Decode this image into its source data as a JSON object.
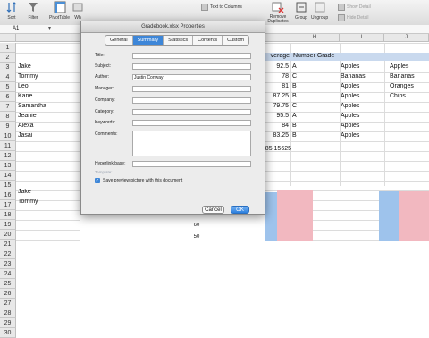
{
  "ribbon": {
    "sort_label": "Sort",
    "filter_label": "Filter",
    "pivot_label": "PivotTable",
    "wh_label": "Wh",
    "text_to_columns": "Text to Columns",
    "remove_duplicates": "Remove Duplicates",
    "group_label": "Group",
    "ungroup_label": "Ungroup",
    "show_detail": "Show Detail",
    "hide_detail": "Hide Detail"
  },
  "formula_bar": {
    "cell_ref": "A1"
  },
  "columns": [
    "H",
    "I",
    "J"
  ],
  "rows": {
    "numbers": [
      "1",
      "2",
      "3",
      "4",
      "5",
      "6",
      "7",
      "8",
      "9",
      "10",
      "11",
      "12",
      "13",
      "14",
      "15",
      "16",
      "17",
      "18",
      "19",
      "20",
      "21",
      "22",
      "23",
      "24",
      "25",
      "26",
      "27",
      "28",
      "29",
      "30"
    ],
    "names": [
      "Jake",
      "Tommy",
      "Leo",
      "Kane",
      "Samantha",
      "Jeanie",
      "Alexa",
      "Jasai"
    ],
    "names_lower": [
      "Jake",
      "Tommy"
    ]
  },
  "sheet": {
    "header_g": "verage",
    "header_h": "Number Grade",
    "averages": [
      "92.5",
      "78",
      "81",
      "87.25",
      "79.75",
      "95.5",
      "84",
      "83.25"
    ],
    "grades": [
      "A",
      "C",
      "B",
      "B",
      "C",
      "A",
      "B",
      "B"
    ],
    "col_i": [
      "Apples",
      "Bananas",
      "Apples",
      "Apples",
      "Apples",
      "Apples",
      "Apples",
      "Apples"
    ],
    "col_j": [
      "Apples",
      "Bananas",
      "Oranges",
      "Chips"
    ],
    "total_average": "85.15625",
    "bottom_numbers": [
      "60",
      "50"
    ]
  },
  "dialog": {
    "title": "Gradebook.xlsx Properties",
    "tabs": [
      "General",
      "Summary",
      "Statistics",
      "Contents",
      "Custom"
    ],
    "active_tab": "Summary",
    "fields": {
      "title": {
        "label": "Title:",
        "value": ""
      },
      "subject": {
        "label": "Subject:",
        "value": ""
      },
      "author": {
        "label": "Author:",
        "value": "Justin Conway"
      },
      "manager": {
        "label": "Manager:",
        "value": ""
      },
      "company": {
        "label": "Company:",
        "value": ""
      },
      "category": {
        "label": "Category:",
        "value": ""
      },
      "keywords": {
        "label": "Keywords:",
        "value": ""
      },
      "comments": {
        "label": "Comments:",
        "value": ""
      },
      "hyperlink_base": {
        "label": "Hyperlink base:",
        "value": ""
      }
    },
    "template_label": "Template:",
    "save_preview_label": "Save preview picture with this document",
    "save_preview_checked": true,
    "cancel_label": "Cancel",
    "ok_label": "OK"
  },
  "colors": {
    "accent": "#3d86d8",
    "chart_pink": "#f2b8c0",
    "chart_blue": "#9ec3ec",
    "header_highlight": "#c9d9ee"
  }
}
